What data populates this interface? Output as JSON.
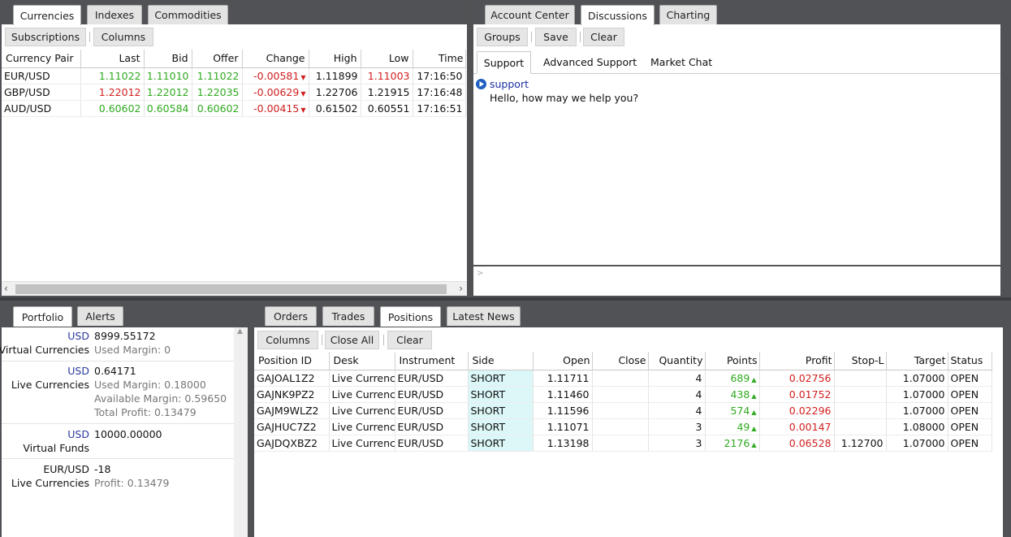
{
  "top_left": {
    "tabs": [
      {
        "label": "Currencies"
      },
      {
        "label": "Indexes"
      },
      {
        "label": "Commodities"
      }
    ],
    "toolbar": {
      "subscriptions": "Subscriptions",
      "columns": "Columns"
    },
    "columns": [
      "Currency Pair",
      "Last",
      "Bid",
      "Offer",
      "Change",
      "High",
      "Low",
      "Time"
    ],
    "rows": [
      {
        "pair": "EUR/USD",
        "last": "1.11022",
        "bid": "1.11010",
        "offer": "1.11022",
        "change": "-0.00581",
        "high": "1.11899",
        "low": "1.11003",
        "time": "17:16:50"
      },
      {
        "pair": "GBP/USD",
        "last": "1.22012",
        "bid": "1.22012",
        "offer": "1.22035",
        "change": "-0.00629",
        "high": "1.22706",
        "low": "1.21915",
        "time": "17:16:48"
      },
      {
        "pair": "AUD/USD",
        "last": "0.60602",
        "bid": "0.60584",
        "offer": "0.60602",
        "change": "-0.00415",
        "high": "0.61502",
        "low": "0.60551",
        "time": "17:16:51"
      }
    ]
  },
  "top_right": {
    "tabs": [
      {
        "label": "Account Center"
      },
      {
        "label": "Discussions"
      },
      {
        "label": "Charting"
      }
    ],
    "toolbar": {
      "groups": "Groups",
      "save": "Save",
      "clear": "Clear"
    },
    "subtabs": [
      {
        "label": "Support"
      },
      {
        "label": "Advanced Support"
      },
      {
        "label": "Market Chat"
      }
    ],
    "message": {
      "sender": "support",
      "text": "Hello, how may we help you?"
    },
    "input_prompt": ">"
  },
  "bottom_left": {
    "tabs": [
      {
        "label": "Portfolio"
      },
      {
        "label": "Alerts"
      }
    ],
    "blocks": [
      {
        "currency": "USD",
        "value": "8999.55172",
        "name": "Virtual Currencies",
        "details": [
          "Used Margin:  0"
        ]
      },
      {
        "currency": "USD",
        "value": "0.64171",
        "name": "Live Currencies",
        "details": [
          "Used Margin:  0.18000",
          "Available Margin:  0.59650",
          "Total Profit:  0.13479"
        ]
      },
      {
        "currency": "USD",
        "value": "10000.00000",
        "name": "Virtual Funds",
        "details": []
      },
      {
        "currency": "EUR/USD",
        "value": "-18",
        "name": "Live Currencies",
        "details": [
          "Profit:  0.13479"
        ]
      }
    ]
  },
  "bottom_right": {
    "tabs": [
      {
        "label": "Orders"
      },
      {
        "label": "Trades"
      },
      {
        "label": "Positions"
      },
      {
        "label": "Latest News"
      }
    ],
    "toolbar": {
      "columns": "Columns",
      "close_all": "Close All",
      "clear": "Clear"
    },
    "columns": [
      "Position ID",
      "Desk",
      "Instrument",
      "Side",
      "Open",
      "Close",
      "Quantity",
      "Points",
      "Profit",
      "Stop-L",
      "Target",
      "Status"
    ],
    "rows": [
      {
        "id": "GAJOAL1Z2",
        "desk": "Live Currencies",
        "instrument": "EUR/USD",
        "side": "SHORT",
        "open": "1.11711",
        "close": "",
        "quantity": "4",
        "points": "689",
        "profit": "0.02756",
        "stop": "",
        "target": "1.07000",
        "status": "OPEN"
      },
      {
        "id": "GAJNK9PZ2",
        "desk": "Live Currencies",
        "instrument": "EUR/USD",
        "side": "SHORT",
        "open": "1.11460",
        "close": "",
        "quantity": "4",
        "points": "438",
        "profit": "0.01752",
        "stop": "",
        "target": "1.07000",
        "status": "OPEN"
      },
      {
        "id": "GAJM9WLZ2",
        "desk": "Live Currencies",
        "instrument": "EUR/USD",
        "side": "SHORT",
        "open": "1.11596",
        "close": "",
        "quantity": "4",
        "points": "574",
        "profit": "0.02296",
        "stop": "",
        "target": "1.07000",
        "status": "OPEN"
      },
      {
        "id": "GAJHUC7Z2",
        "desk": "Live Currencies",
        "instrument": "EUR/USD",
        "side": "SHORT",
        "open": "1.11071",
        "close": "",
        "quantity": "3",
        "points": "49",
        "profit": "0.00147",
        "stop": "",
        "target": "1.08000",
        "status": "OPEN"
      },
      {
        "id": "GAJDQXBZ2",
        "desk": "Live Currencies",
        "instrument": "EUR/USD",
        "side": "SHORT",
        "open": "1.13198",
        "close": "",
        "quantity": "3",
        "points": "2176",
        "profit": "0.06528",
        "stop": "1.12700",
        "target": "1.07000",
        "status": "OPEN"
      }
    ]
  },
  "colors": {
    "up": "#2faa1f",
    "down": "#d11f1f",
    "short_bg": "#dcf7f8",
    "frame": "#505256"
  }
}
